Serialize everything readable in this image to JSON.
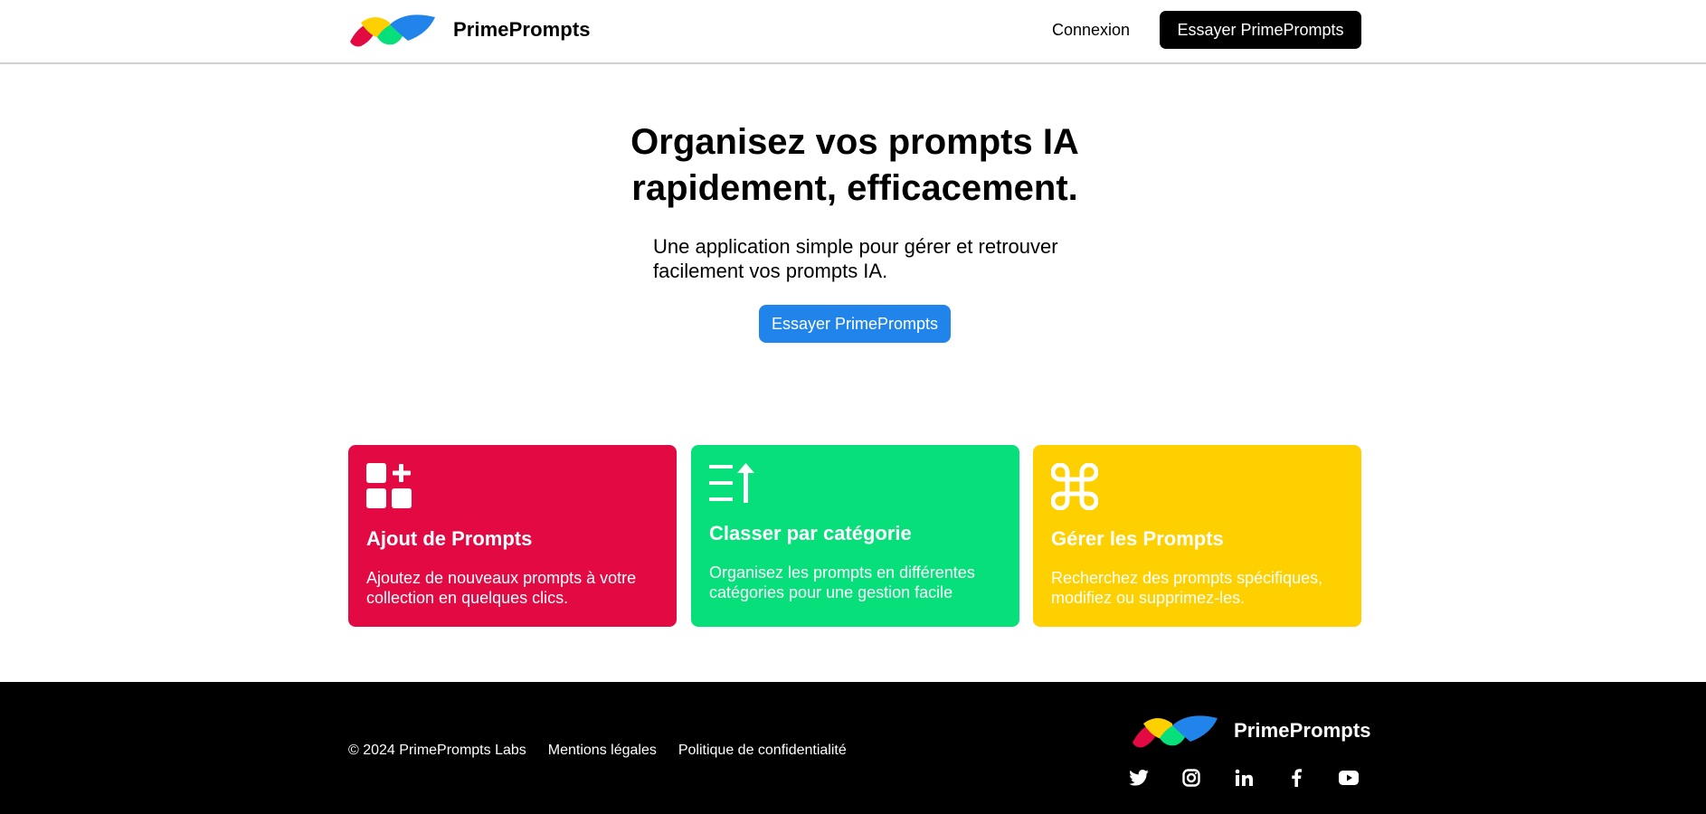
{
  "header": {
    "brand_name": "PrimePrompts",
    "login_label": "Connexion",
    "cta_label": "Essayer PrimePrompts"
  },
  "hero": {
    "title_line1": "Organisez vos prompts IA",
    "title_line2": "rapidement, efficacement.",
    "subtitle_line1": "Une application simple pour gérer et retrouver",
    "subtitle_line2": "facilement vos prompts IA.",
    "cta_label": "Essayer PrimePrompts"
  },
  "features": [
    {
      "icon": "grid-plus-icon",
      "title": "Ajout de Prompts",
      "text_line1": "Ajoutez de nouveaux prompts à votre",
      "text_line2": "collection en quelques clics.",
      "color": "#e30943"
    },
    {
      "icon": "sort-list-icon",
      "title": "Classer par catégorie",
      "text_line1": "Organisez les prompts en différentes",
      "text_line2": "catégories pour une gestion facile",
      "color": "#07e07a"
    },
    {
      "icon": "command-icon",
      "title": "Gérer les Prompts",
      "text_line1": "Recherchez des prompts spécifiques,",
      "text_line2": "modifiez ou supprimez-les.",
      "color": "#fed000"
    }
  ],
  "footer": {
    "copyright": "© 2024 PrimePrompts Labs",
    "legal_label": "Mentions légales",
    "privacy_label": "Politique de confidentialité",
    "brand_name": "PrimePrompts",
    "socials": [
      "twitter-icon",
      "instagram-icon",
      "linkedin-icon",
      "facebook-icon",
      "youtube-icon"
    ]
  },
  "colors": {
    "brand_red": "#e30943",
    "brand_yellow": "#fed000",
    "brand_green": "#07e07a",
    "brand_blue": "#2184ea",
    "primary_button": "#000000",
    "hero_button": "#2184ea"
  }
}
